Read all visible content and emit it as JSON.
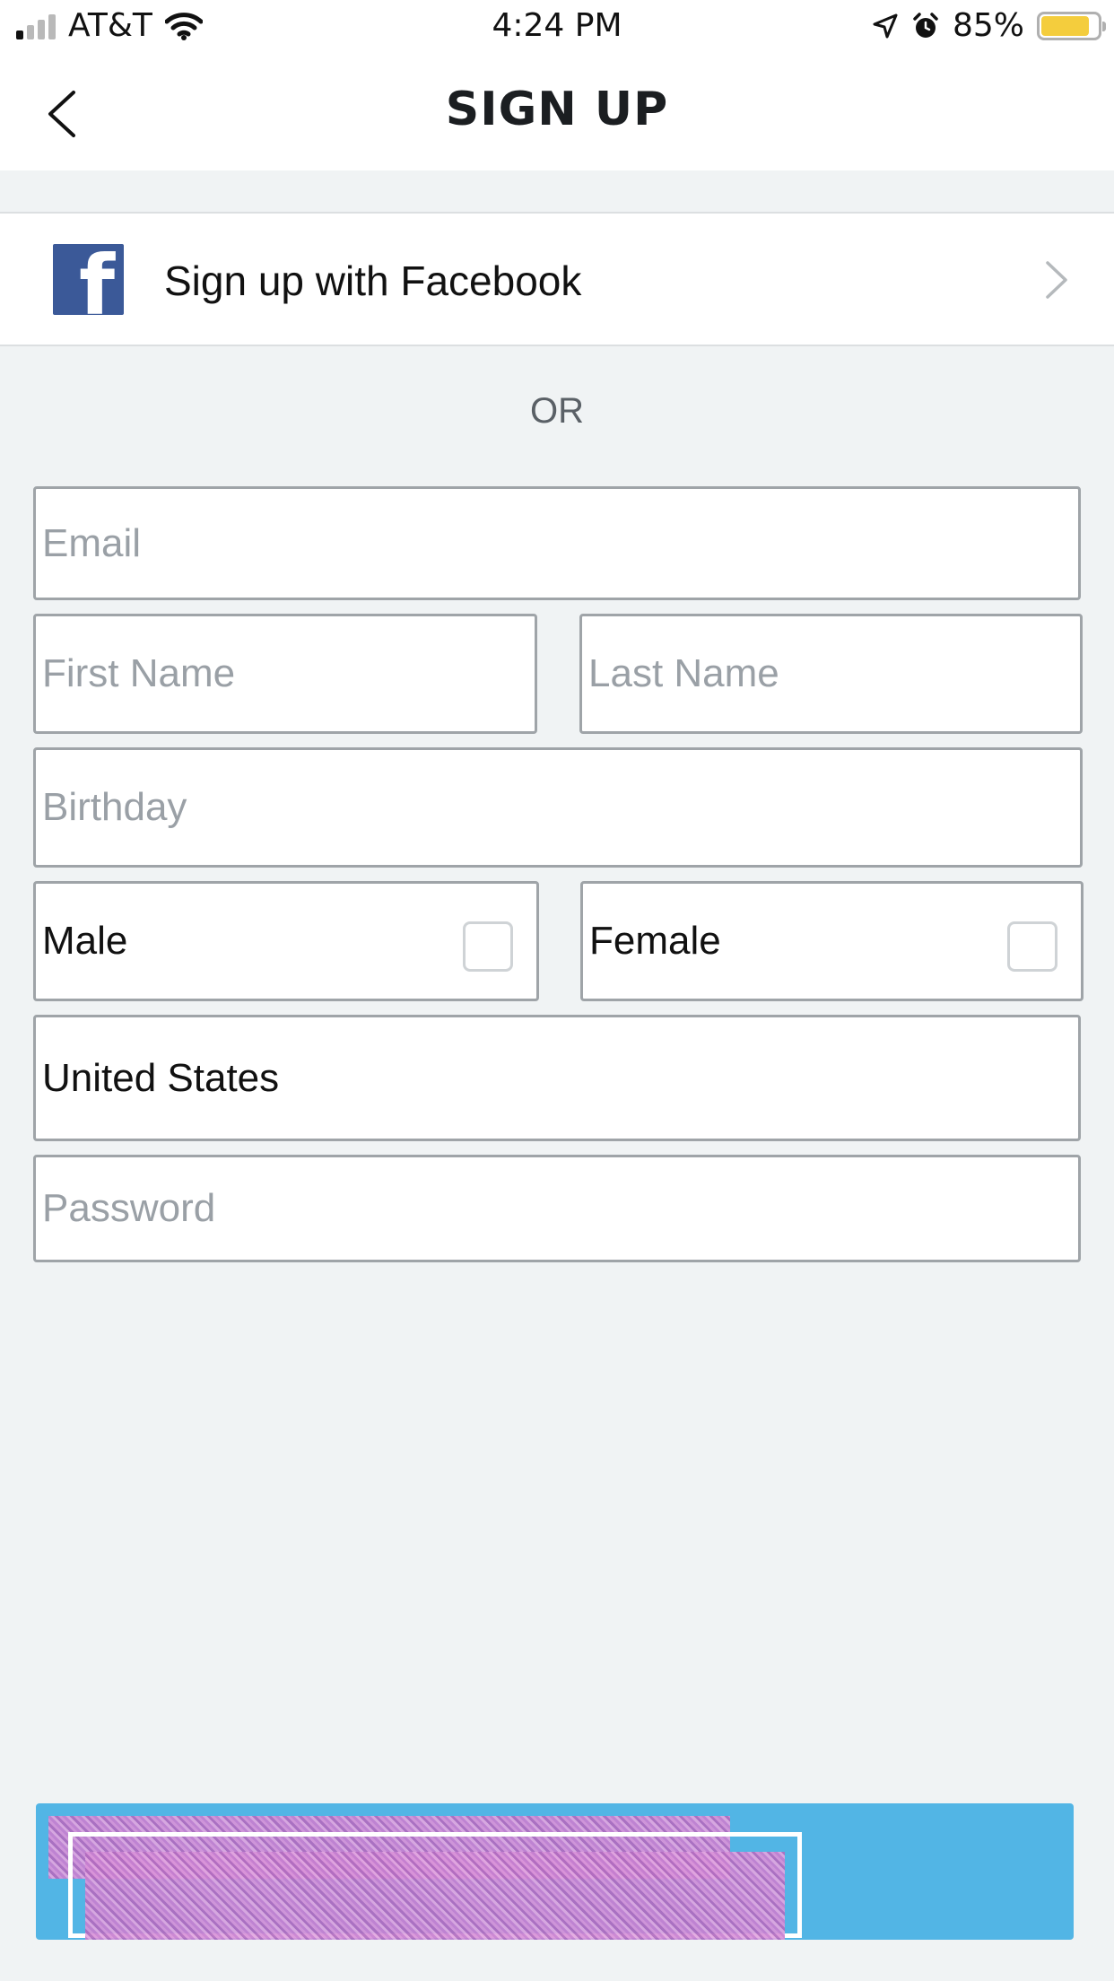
{
  "status_bar": {
    "carrier": "AT&T",
    "time": "4:24 PM",
    "battery_percent": "85%",
    "battery_level": 0.85,
    "icons": [
      "signal-icon",
      "wifi-icon",
      "location-icon",
      "alarm-icon",
      "battery-icon"
    ]
  },
  "header": {
    "title": "SIGN UP",
    "back_icon": "chevron-left-icon"
  },
  "facebook": {
    "label": "Sign up with Facebook",
    "icon": "facebook-icon",
    "icon_glyph": "f",
    "brand_color": "#3b5998",
    "chevron_icon": "chevron-right-icon"
  },
  "divider": {
    "text": "OR"
  },
  "form": {
    "email": {
      "placeholder": "Email",
      "value": ""
    },
    "first_name": {
      "placeholder": "First Name",
      "value": ""
    },
    "last_name": {
      "placeholder": "Last Name",
      "value": ""
    },
    "birthday": {
      "placeholder": "Birthday",
      "value": ""
    },
    "gender": {
      "male": {
        "label": "Male",
        "checked": false
      },
      "female": {
        "label": "Female",
        "checked": false
      }
    },
    "country": {
      "value": "United States"
    },
    "password": {
      "placeholder": "Password",
      "value": ""
    }
  },
  "submit": {
    "label": "",
    "color": "#52b5e5"
  }
}
